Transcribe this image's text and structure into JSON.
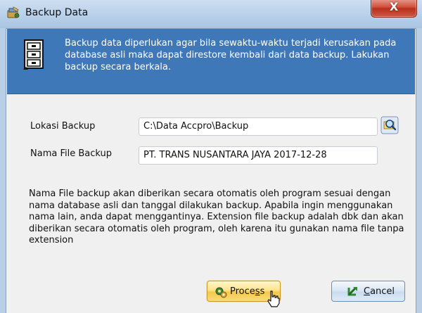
{
  "window": {
    "title": "Backup Data",
    "close_glyph": "X",
    "title_icon": "backup-app-icon"
  },
  "header": {
    "description": "Backup data diperlukan agar bila sewaktu-waktu terjadi kerusakan pada database asli maka dapat direstore kembali dari data backup. Lakukan backup secara berkala.",
    "icon": "file-cabinet-icon"
  },
  "form": {
    "location_label": "Lokasi Backup",
    "location_value": "C:\\Data Accpro\\Backup",
    "filename_label": "Nama File Backup",
    "filename_value": "PT. TRANS NUSANTARA JAYA 2017-12-28",
    "browse_icon": "browse-folder-search-icon"
  },
  "info": {
    "text": "Nama File backup akan diberikan secara otomatis oleh program sesuai dengan nama database asli dan tanggal dilakukan backup. Apabila ingin menggunakan nama lain, anda dapat menggantinya. Extension file backup adalah dbk dan akan diberikan secara otomatis oleh program, oleh karena itu gunakan nama file tanpa extension"
  },
  "buttons": {
    "process_pre": "Proce",
    "process_mnemonic": "s",
    "process_post": "s",
    "cancel_mnemonic": "C",
    "cancel_post": "ancel"
  },
  "colors": {
    "header_bg": "#3f78b8",
    "process_button": "#f5c84a",
    "cancel_button": "#c9dcef",
    "close_button": "#d3523f"
  }
}
